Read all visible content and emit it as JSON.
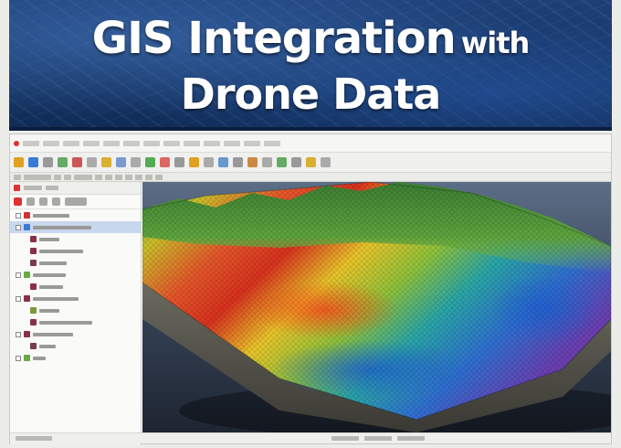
{
  "banner": {
    "title_line1_big": "GIS Integration",
    "title_line1_small": "with",
    "title_line2": "Drone Data"
  },
  "colors": {
    "banner_blue": "#173667",
    "terrain_red": "#d8321e",
    "terrain_yellow": "#e8c42a",
    "terrain_green": "#4a9a3a",
    "terrain_blue": "#2f6fd0",
    "layer_selected": "#c7d7ee"
  },
  "icons": [
    "close-icon",
    "layer-checkbox-icon",
    "layer-symbol-icon",
    "terrain-3d-icon"
  ]
}
